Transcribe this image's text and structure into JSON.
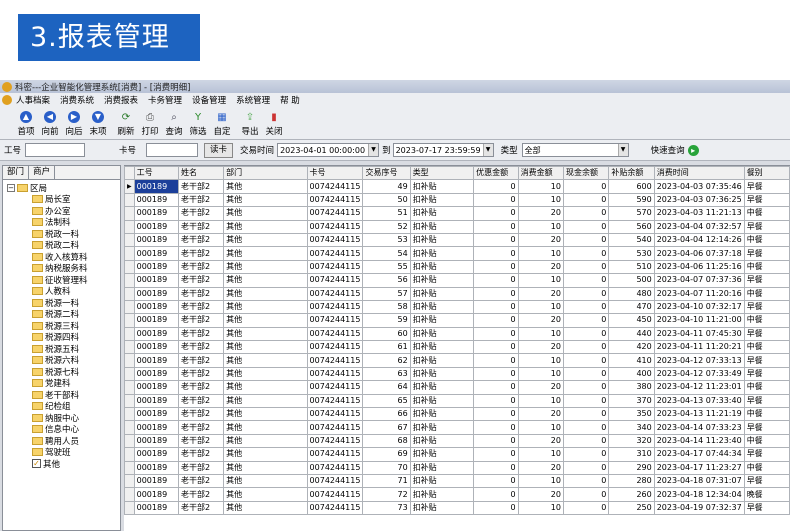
{
  "banner": {
    "title": "3.报表管理"
  },
  "window": {
    "title": "科密---企业智能化管理系统[消费] - [消费明细]"
  },
  "menu": [
    "人事档案",
    "消费系统",
    "消费报表",
    "卡务管理",
    "设备管理",
    "系统管理",
    "帮 助"
  ],
  "toolbar": [
    {
      "label": "首项",
      "icon": "first-icon",
      "glyph": "▲"
    },
    {
      "label": "向前",
      "icon": "prev-icon",
      "glyph": "◀"
    },
    {
      "label": "向后",
      "icon": "next-icon",
      "glyph": "▶"
    },
    {
      "label": "末项",
      "icon": "last-icon",
      "glyph": "▼"
    },
    {
      "label": "刷新",
      "icon": "refresh-icon",
      "glyph": "⟳"
    },
    {
      "label": "打印",
      "icon": "print-icon",
      "glyph": "⎙"
    },
    {
      "label": "查询",
      "icon": "query-icon",
      "glyph": "⌕"
    },
    {
      "label": "筛选",
      "icon": "filter-icon",
      "glyph": "Y"
    },
    {
      "label": "自定",
      "icon": "custom-icon",
      "glyph": "▦"
    },
    {
      "label": "导出",
      "icon": "export-icon",
      "glyph": "⇪"
    },
    {
      "label": "关闭",
      "icon": "close-icon",
      "glyph": "▮"
    }
  ],
  "filter": {
    "gonghao_label": "工号",
    "gonghao_value": "",
    "kahao_label": "卡号",
    "kahao_value": "",
    "readcard": "读卡",
    "time_label": "交易时间",
    "time_from": "2023-04-01 00:00:00",
    "to_label": "到",
    "time_to": "2023-07-17 23:59:59",
    "type_label": "类型",
    "type_value": "全部",
    "quick": "快速查询"
  },
  "left": {
    "tabs": [
      "部门",
      "商户"
    ],
    "root": "区局",
    "nodes": [
      "局长室",
      "办公室",
      "法制科",
      "税政一科",
      "税政二科",
      "收入核算科",
      "纳税服务科",
      "征收管理科",
      "人教科",
      "税源一科",
      "税源二科",
      "税源三科",
      "税源四科",
      "税源五科",
      "税源六科",
      "税源七科",
      "党建科",
      "老干部科",
      "纪检组",
      "纳服中心",
      "信息中心",
      "聘用人员",
      "驾驶班",
      "其他"
    ]
  },
  "grid": {
    "columns": [
      "工号",
      "姓名",
      "部门",
      "卡号",
      "交易序号",
      "类型",
      "优惠金额",
      "消费金额",
      "现金余额",
      "补贴余额",
      "消费时间",
      "餐别"
    ],
    "rows": [
      [
        "000189",
        "老干部2",
        "其他",
        "0074244115",
        "49",
        "扣补贴",
        "0",
        "10",
        "0",
        "600",
        "2023-04-03 07:35:46",
        "早餐"
      ],
      [
        "000189",
        "老干部2",
        "其他",
        "0074244115",
        "50",
        "扣补贴",
        "0",
        "10",
        "0",
        "590",
        "2023-04-03 07:36:25",
        "早餐"
      ],
      [
        "000189",
        "老干部2",
        "其他",
        "0074244115",
        "51",
        "扣补贴",
        "0",
        "20",
        "0",
        "570",
        "2023-04-03 11:21:13",
        "中餐"
      ],
      [
        "000189",
        "老干部2",
        "其他",
        "0074244115",
        "52",
        "扣补贴",
        "0",
        "10",
        "0",
        "560",
        "2023-04-04 07:32:57",
        "早餐"
      ],
      [
        "000189",
        "老干部2",
        "其他",
        "0074244115",
        "53",
        "扣补贴",
        "0",
        "20",
        "0",
        "540",
        "2023-04-04 12:14:26",
        "中餐"
      ],
      [
        "000189",
        "老干部2",
        "其他",
        "0074244115",
        "54",
        "扣补贴",
        "0",
        "10",
        "0",
        "530",
        "2023-04-06 07:37:18",
        "早餐"
      ],
      [
        "000189",
        "老干部2",
        "其他",
        "0074244115",
        "55",
        "扣补贴",
        "0",
        "20",
        "0",
        "510",
        "2023-04-06 11:25:16",
        "中餐"
      ],
      [
        "000189",
        "老干部2",
        "其他",
        "0074244115",
        "56",
        "扣补贴",
        "0",
        "10",
        "0",
        "500",
        "2023-04-07 07:37:36",
        "早餐"
      ],
      [
        "000189",
        "老干部2",
        "其他",
        "0074244115",
        "57",
        "扣补贴",
        "0",
        "20",
        "0",
        "480",
        "2023-04-07 11:20:16",
        "中餐"
      ],
      [
        "000189",
        "老干部2",
        "其他",
        "0074244115",
        "58",
        "扣补贴",
        "0",
        "10",
        "0",
        "470",
        "2023-04-10 07:32:17",
        "早餐"
      ],
      [
        "000189",
        "老干部2",
        "其他",
        "0074244115",
        "59",
        "扣补贴",
        "0",
        "20",
        "0",
        "450",
        "2023-04-10 11:21:00",
        "中餐"
      ],
      [
        "000189",
        "老干部2",
        "其他",
        "0074244115",
        "60",
        "扣补贴",
        "0",
        "10",
        "0",
        "440",
        "2023-04-11 07:45:30",
        "早餐"
      ],
      [
        "000189",
        "老干部2",
        "其他",
        "0074244115",
        "61",
        "扣补贴",
        "0",
        "20",
        "0",
        "420",
        "2023-04-11 11:20:21",
        "中餐"
      ],
      [
        "000189",
        "老干部2",
        "其他",
        "0074244115",
        "62",
        "扣补贴",
        "0",
        "10",
        "0",
        "410",
        "2023-04-12 07:33:13",
        "早餐"
      ],
      [
        "000189",
        "老干部2",
        "其他",
        "0074244115",
        "63",
        "扣补贴",
        "0",
        "10",
        "0",
        "400",
        "2023-04-12 07:33:49",
        "早餐"
      ],
      [
        "000189",
        "老干部2",
        "其他",
        "0074244115",
        "64",
        "扣补贴",
        "0",
        "20",
        "0",
        "380",
        "2023-04-12 11:23:01",
        "中餐"
      ],
      [
        "000189",
        "老干部2",
        "其他",
        "0074244115",
        "65",
        "扣补贴",
        "0",
        "10",
        "0",
        "370",
        "2023-04-13 07:33:40",
        "早餐"
      ],
      [
        "000189",
        "老干部2",
        "其他",
        "0074244115",
        "66",
        "扣补贴",
        "0",
        "20",
        "0",
        "350",
        "2023-04-13 11:21:19",
        "中餐"
      ],
      [
        "000189",
        "老干部2",
        "其他",
        "0074244115",
        "67",
        "扣补贴",
        "0",
        "10",
        "0",
        "340",
        "2023-04-14 07:33:23",
        "早餐"
      ],
      [
        "000189",
        "老干部2",
        "其他",
        "0074244115",
        "68",
        "扣补贴",
        "0",
        "20",
        "0",
        "320",
        "2023-04-14 11:23:40",
        "中餐"
      ],
      [
        "000189",
        "老干部2",
        "其他",
        "0074244115",
        "69",
        "扣补贴",
        "0",
        "10",
        "0",
        "310",
        "2023-04-17 07:44:34",
        "早餐"
      ],
      [
        "000189",
        "老干部2",
        "其他",
        "0074244115",
        "70",
        "扣补贴",
        "0",
        "20",
        "0",
        "290",
        "2023-04-17 11:23:27",
        "中餐"
      ],
      [
        "000189",
        "老干部2",
        "其他",
        "0074244115",
        "71",
        "扣补贴",
        "0",
        "10",
        "0",
        "280",
        "2023-04-18 07:31:07",
        "早餐"
      ],
      [
        "000189",
        "老干部2",
        "其他",
        "0074244115",
        "72",
        "扣补贴",
        "0",
        "20",
        "0",
        "260",
        "2023-04-18 12:34:04",
        "晚餐"
      ],
      [
        "000189",
        "老干部2",
        "其他",
        "0074244115",
        "73",
        "扣补贴",
        "0",
        "10",
        "0",
        "250",
        "2023-04-19 07:32:37",
        "早餐"
      ]
    ]
  }
}
